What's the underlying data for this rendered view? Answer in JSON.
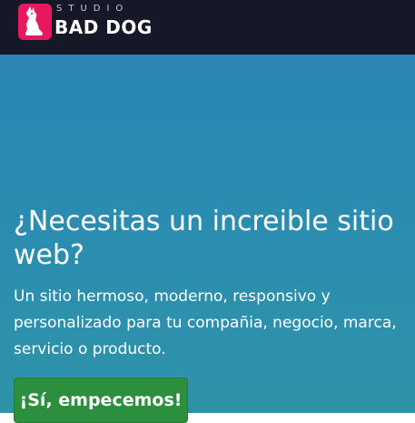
{
  "navbar": {
    "logo_icon": "dog-icon",
    "brand_small": "STUDIO",
    "brand_name": "BAD DOG",
    "colors": {
      "background": "#161828",
      "logo_badge": "#e6185f"
    }
  },
  "hero": {
    "title": "¿Necesitas un increible sitio web?",
    "subtitle": "Un sitio hermoso, moderno, responsivo y personalizado para tu compañia, negocio, marca, servicio o producto.",
    "cta_label": "¡Sí, empecemos!",
    "colors": {
      "background": "#2b8ab3",
      "cta": "#2c8f3e"
    }
  }
}
